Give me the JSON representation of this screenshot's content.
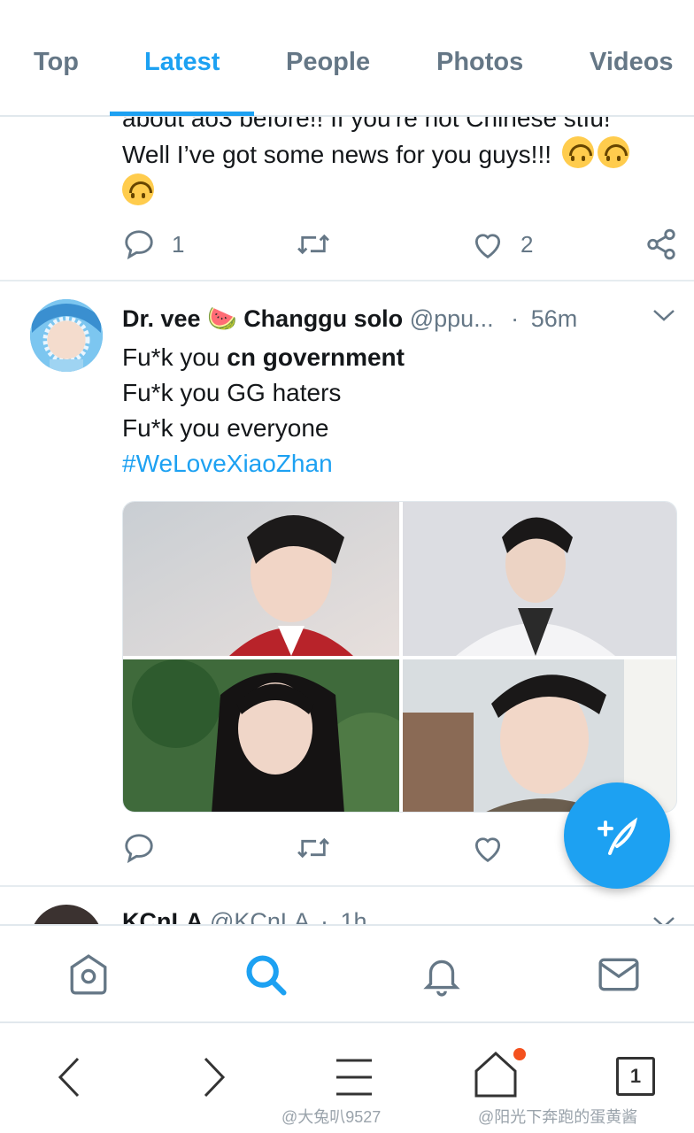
{
  "tabs": [
    {
      "label": "Top"
    },
    {
      "label": "Latest"
    },
    {
      "label": "People"
    },
    {
      "label": "Photos"
    },
    {
      "label": "Videos"
    }
  ],
  "tweet_prev": {
    "text_partial": "about ao3 before!! If you're not Chinese stfu!",
    "text_line": "Well I’ve got some news for you guys!!!",
    "reply_count": "1",
    "like_count": "2"
  },
  "tweet_main": {
    "display_name": "Dr. vee 🍉 Changgu solo",
    "handle": "@ppu...",
    "separator": "·",
    "time": "56m",
    "line1_prefix": "Fu*k you ",
    "line1_bold": "cn government",
    "line2": "Fu*k you GG haters",
    "line3": "Fu*k you everyone",
    "hashtag": "#WeLoveXiaoZhan"
  },
  "tweet_next": {
    "display_name": "KCnLA",
    "handle": "@KCnLA",
    "separator": "·",
    "time": "1h"
  },
  "system": {
    "tab_count": "1"
  },
  "watermarks": {
    "left": "@大兔叭9527",
    "right": "@阳光下奔跑的蛋黄酱"
  },
  "colors": {
    "accent": "#1da1f2",
    "muted": "#657786",
    "notification_dot": "#f4511e"
  }
}
